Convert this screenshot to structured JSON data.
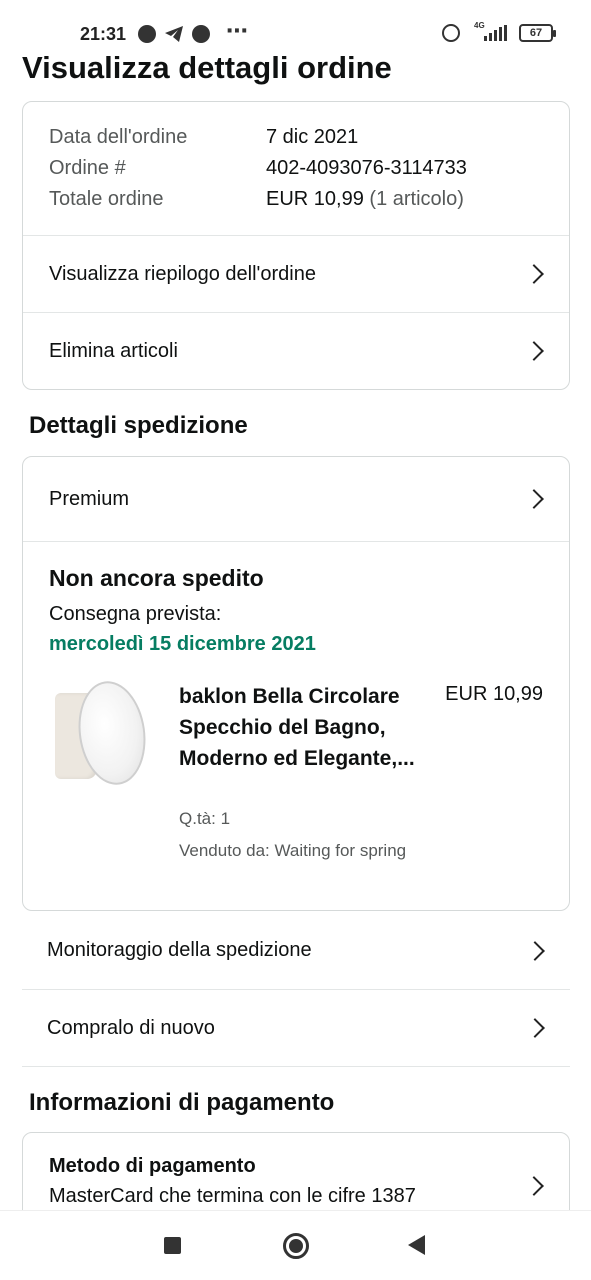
{
  "status_bar": {
    "time": "21:31",
    "network": "4G",
    "battery": "67",
    "overflow": "⋯"
  },
  "page": {
    "title": "Visualizza dettagli ordine"
  },
  "order_summary": {
    "date_label": "Data dell'ordine",
    "date_value": "7 dic 2021",
    "number_label": "Ordine #",
    "number_value": "402-4093076-3114733",
    "total_label": "Totale ordine",
    "total_value": "EUR 10,99",
    "total_items": "(1 articolo)",
    "view_summary_label": "Visualizza riepilogo dell'ordine",
    "delete_items_label": "Elimina articoli"
  },
  "shipping": {
    "section_title": "Dettagli spedizione",
    "shipping_type": "Premium",
    "status": "Non ancora spedito",
    "delivery_label": "Consegna prevista:",
    "delivery_date": "mercoledì 15 dicembre 2021",
    "delivery_date_color": "#067d62",
    "product": {
      "title": "baklon Bella Circolare Specchio del Bagno, Moderno ed Elegante,...",
      "price": "EUR 10,99",
      "quantity": "Q.tà: 1",
      "seller": "Venduto da: Waiting for spring"
    },
    "track_label": "Monitoraggio della spedizione",
    "buy_again_label": "Compralo di nuovo"
  },
  "payment": {
    "section_title": "Informazioni di pagamento",
    "method_label": "Metodo di pagamento",
    "method_value": "MasterCard che termina con le cifre 1387"
  }
}
